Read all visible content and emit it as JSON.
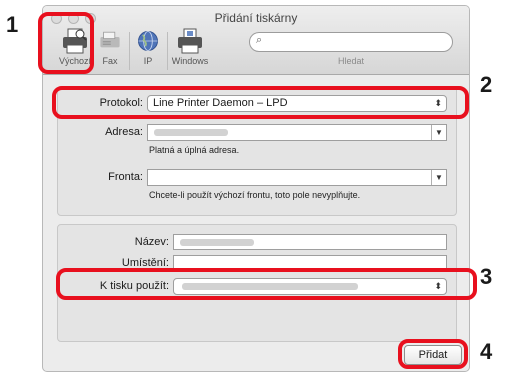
{
  "window": {
    "title": "Přidání tiskárny"
  },
  "toolbar": {
    "buttons": [
      {
        "label": "Výchozí",
        "icon": "printer-default-icon"
      },
      {
        "label": "Fax",
        "icon": "fax-icon"
      },
      {
        "label": "IP",
        "icon": "globe-icon"
      },
      {
        "label": "Windows",
        "icon": "windows-printer-icon"
      }
    ],
    "search_label": "Hledat",
    "search_placeholder": ""
  },
  "form": {
    "protocol": {
      "label": "Protokol:",
      "value": "Line Printer Daemon – LPD"
    },
    "address": {
      "label": "Adresa:",
      "hint": "Platná a úplná adresa."
    },
    "queue": {
      "label": "Fronta:",
      "hint": "Chcete-li použít výchozí frontu, toto pole nevyplňujte."
    },
    "name": {
      "label": "Název:"
    },
    "location": {
      "label": "Umístění:"
    },
    "use_driver": {
      "label": "K tisku použít:"
    }
  },
  "actions": {
    "add_label": "Přidat"
  },
  "callouts": [
    "1",
    "2",
    "3",
    "4"
  ],
  "colors": {
    "callout_red": "#e8101e"
  }
}
